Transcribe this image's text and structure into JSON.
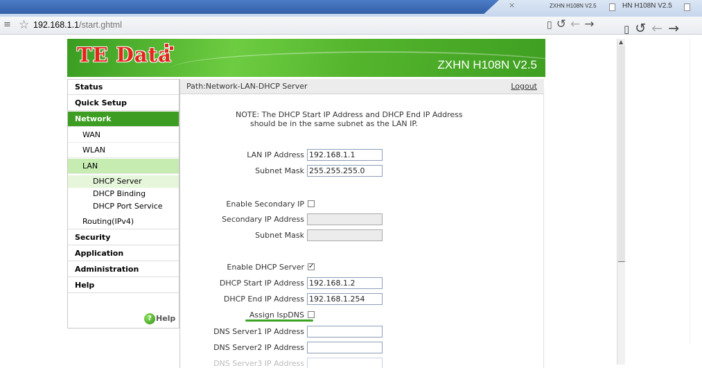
{
  "browser": {
    "close_glyph": "×",
    "tab_title": "ZXHN H108N V2.5",
    "tab_title_2": "HN H108N V2.5",
    "url_host": "192.168.1.1",
    "url_path": "/start.ghtml",
    "icons": [
      "menu-icon",
      "star-icon",
      "page-icon",
      "reload-icon",
      "back-icon",
      "forward-icon"
    ]
  },
  "header": {
    "logo_te": "TE",
    "logo_data": " Data",
    "model": "ZXHN H108N V2.5"
  },
  "sidebar": {
    "items": [
      {
        "label": "Status"
      },
      {
        "label": "Quick Setup"
      },
      {
        "label": "Network"
      },
      {
        "label": "WAN"
      },
      {
        "label": "WLAN"
      },
      {
        "label": "LAN"
      },
      {
        "label": "DHCP Server"
      },
      {
        "label": "DHCP Binding"
      },
      {
        "label": "DHCP Port Service"
      },
      {
        "label": "Routing(IPv4)"
      },
      {
        "label": "Security"
      },
      {
        "label": "Application"
      },
      {
        "label": "Administration"
      },
      {
        "label": "Help"
      }
    ],
    "help_label": "Help",
    "help_glyph": "?"
  },
  "content": {
    "path": "Path:Network-LAN-DHCP Server",
    "logout": "Logout",
    "note": "NOTE: The DHCP Start IP Address and DHCP End IP Address\n      should be in the same subnet as the LAN IP.",
    "fields": {
      "lan_ip_label": "LAN IP Address",
      "lan_ip_value": "192.168.1.1",
      "subnet_label": "Subnet Mask",
      "subnet_value": "255.255.255.0",
      "enable_secondary_label": "Enable Secondary IP",
      "secondary_ip_label": "Secondary IP Address",
      "secondary_subnet_label": "Subnet Mask",
      "enable_dhcp_label": "Enable DHCP Server",
      "dhcp_start_label": "DHCP Start IP Address",
      "dhcp_start_value": "192.168.1.2",
      "dhcp_end_label": "DHCP End IP Address",
      "dhcp_end_value": "192.168.1.254",
      "assign_isp_dns_label": "Assign IspDNS",
      "dns1_label": "DNS Server1 IP Address",
      "dns2_label": "DNS Server2 IP Address",
      "dns3_label": "DNS Server3 IP Address"
    },
    "checked_mark": "✓"
  },
  "colors": {
    "brand_green": "#3c9d22",
    "logo_red": "#e2261c"
  }
}
